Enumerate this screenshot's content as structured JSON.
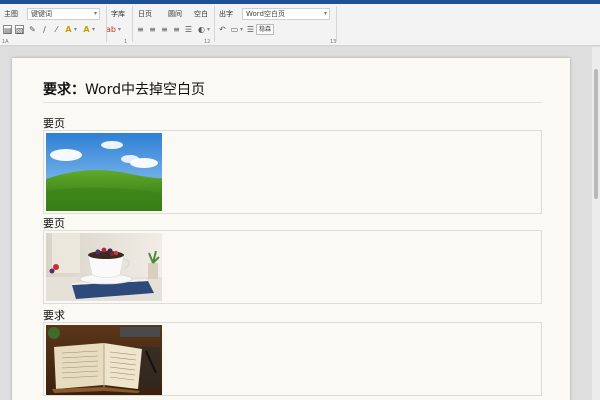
{
  "ribbon": {
    "tabs": [
      "主图",
      "字库",
      "日页",
      "圆间",
      "空白",
      "出字"
    ],
    "keyword_input": "键键词",
    "search_input": "Word空白页",
    "small_button": "稳森",
    "group_labels": [
      "1A",
      "1",
      "12",
      "13"
    ]
  },
  "document": {
    "title_bold": "要求：",
    "title_rest": "Word中去掉空白页",
    "sections": [
      {
        "label": "要页",
        "image": "hill-landscape-image"
      },
      {
        "label": "要页",
        "image": "coffee-cup-image"
      },
      {
        "label": "要求",
        "image": "open-book-image"
      }
    ]
  }
}
